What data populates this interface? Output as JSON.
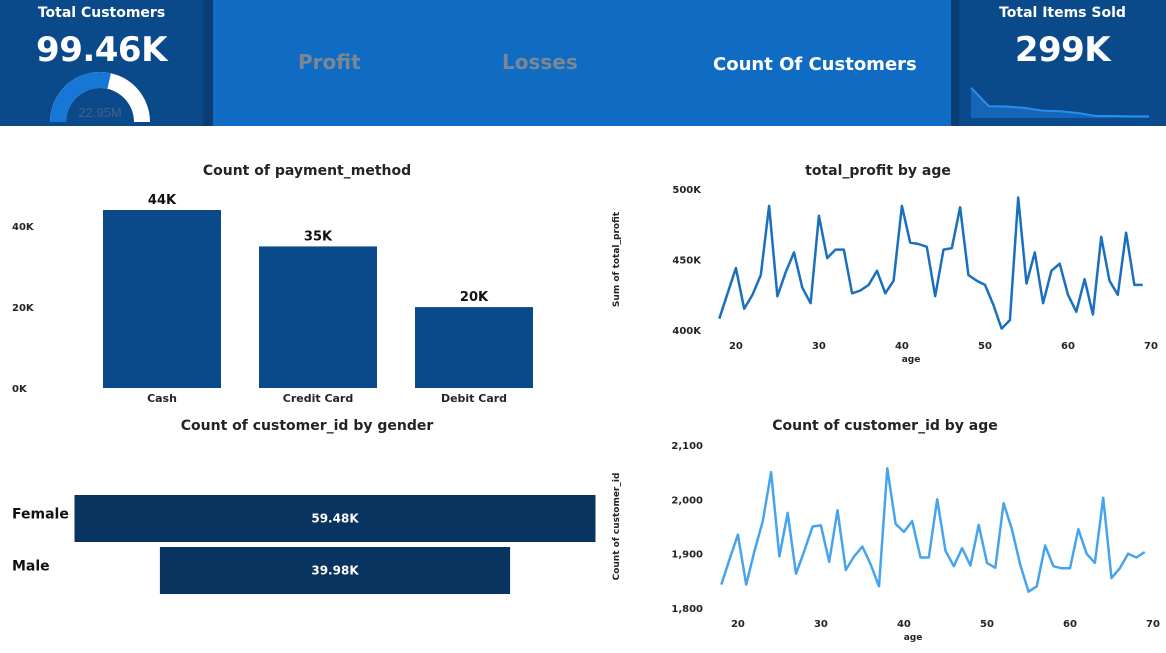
{
  "kpis": {
    "total_customers": {
      "title": "Total Customers",
      "value": "99.46K",
      "gauge_label": "22.95M",
      "gauge_fraction": 0.57
    },
    "total_items_sold": {
      "title": "Total Items Sold",
      "value": "299K",
      "sparkline": [
        9,
        3.5,
        3.4,
        3.0,
        2.2,
        2.0,
        1.5,
        0.6,
        0.6,
        0.5,
        0.5
      ]
    }
  },
  "nav": {
    "profit": "Profit",
    "losses": "Losses",
    "count_of_customers": "Count Of Customers"
  },
  "colors": {
    "kpi_bg": "#0b4a8a",
    "nav_bg": "#0f6cc2",
    "bar": "#0b4a8a",
    "gender_bar": "#08345f",
    "line_profit": "#1a6fbf",
    "line_customers": "#46a4ee",
    "inactive_nav": "#7b8794"
  },
  "chart_data": [
    {
      "id": "payment",
      "type": "bar",
      "title": "Count of payment_method",
      "categories": [
        "Cash",
        "Credit Card",
        "Debit Card"
      ],
      "values": [
        44,
        35,
        20
      ],
      "data_labels": [
        "44K",
        "35K",
        "20K"
      ],
      "y_ticks": [
        0,
        20,
        40
      ],
      "y_tick_labels": [
        "0K",
        "20K",
        "40K"
      ],
      "ylim": [
        0,
        44
      ]
    },
    {
      "id": "gender",
      "type": "bar",
      "orientation": "horizontal",
      "title": "Count of customer_id by gender",
      "categories": [
        "Female",
        "Male"
      ],
      "values": [
        59.48,
        39.98
      ],
      "data_labels": [
        "59.48K",
        "39.98K"
      ]
    },
    {
      "id": "profit_age",
      "type": "line",
      "title": "total_profit by age",
      "xlabel": "age",
      "ylabel": "Sum of total_profit",
      "x": [
        18,
        19,
        20,
        21,
        22,
        23,
        24,
        25,
        26,
        27,
        28,
        29,
        30,
        31,
        32,
        33,
        34,
        35,
        36,
        37,
        38,
        39,
        40,
        41,
        42,
        43,
        44,
        45,
        46,
        47,
        48,
        49,
        50,
        51,
        52,
        53,
        54,
        55,
        56,
        57,
        58,
        59,
        60,
        61,
        62,
        63,
        64,
        65,
        66,
        67,
        68,
        69
      ],
      "y": [
        408000,
        426000,
        444000,
        415000,
        425000,
        439000,
        488000,
        424000,
        441000,
        455000,
        430000,
        419000,
        481000,
        451000,
        457000,
        457000,
        426000,
        428000,
        432000,
        442000,
        426000,
        435000,
        488000,
        462000,
        461000,
        459000,
        424000,
        457000,
        458000,
        487000,
        439000,
        435000,
        432000,
        418000,
        401000,
        407000,
        494000,
        433000,
        455000,
        419000,
        442000,
        447000,
        425000,
        413000,
        436000,
        411000,
        466000,
        435000,
        425000,
        469000,
        432000,
        432000
      ],
      "x_ticks": [
        20,
        30,
        40,
        50,
        60,
        70
      ],
      "y_ticks": [
        400000,
        450000,
        500000
      ],
      "y_tick_labels": [
        "400K",
        "450K",
        "500K"
      ],
      "xlim": [
        17,
        70
      ],
      "ylim": [
        400000,
        500000
      ]
    },
    {
      "id": "customers_age",
      "type": "line",
      "title": "Count of customer_id by age",
      "xlabel": "age",
      "ylabel": "Count of customer_id",
      "x": [
        18,
        19,
        20,
        21,
        22,
        23,
        24,
        25,
        26,
        27,
        28,
        29,
        30,
        31,
        32,
        33,
        34,
        35,
        36,
        37,
        38,
        39,
        40,
        41,
        42,
        43,
        44,
        45,
        46,
        47,
        48,
        49,
        50,
        51,
        52,
        53,
        54,
        55,
        56,
        57,
        58,
        59,
        60,
        61,
        62,
        63,
        64,
        65,
        66,
        67,
        68,
        69
      ],
      "y": [
        1843,
        1890,
        1935,
        1843,
        1905,
        1960,
        2050,
        1895,
        1975,
        1863,
        1905,
        1950,
        1952,
        1885,
        1980,
        1870,
        1895,
        1913,
        1880,
        1840,
        2057,
        1955,
        1940,
        1960,
        1893,
        1893,
        2000,
        1905,
        1877,
        1910,
        1878,
        1953,
        1883,
        1874,
        1993,
        1945,
        1880,
        1830,
        1840,
        1915,
        1877,
        1873,
        1873,
        1945,
        1900,
        1883,
        2003,
        1855,
        1873,
        1900,
        1893,
        1903
      ],
      "x_ticks": [
        20,
        30,
        40,
        50,
        60,
        70
      ],
      "y_ticks": [
        1800,
        1900,
        2000,
        2100
      ],
      "y_tick_labels": [
        "1,800",
        "1,900",
        "2,000",
        "2,100"
      ],
      "xlim": [
        17,
        70
      ],
      "ylim": [
        1800,
        2100
      ]
    }
  ]
}
